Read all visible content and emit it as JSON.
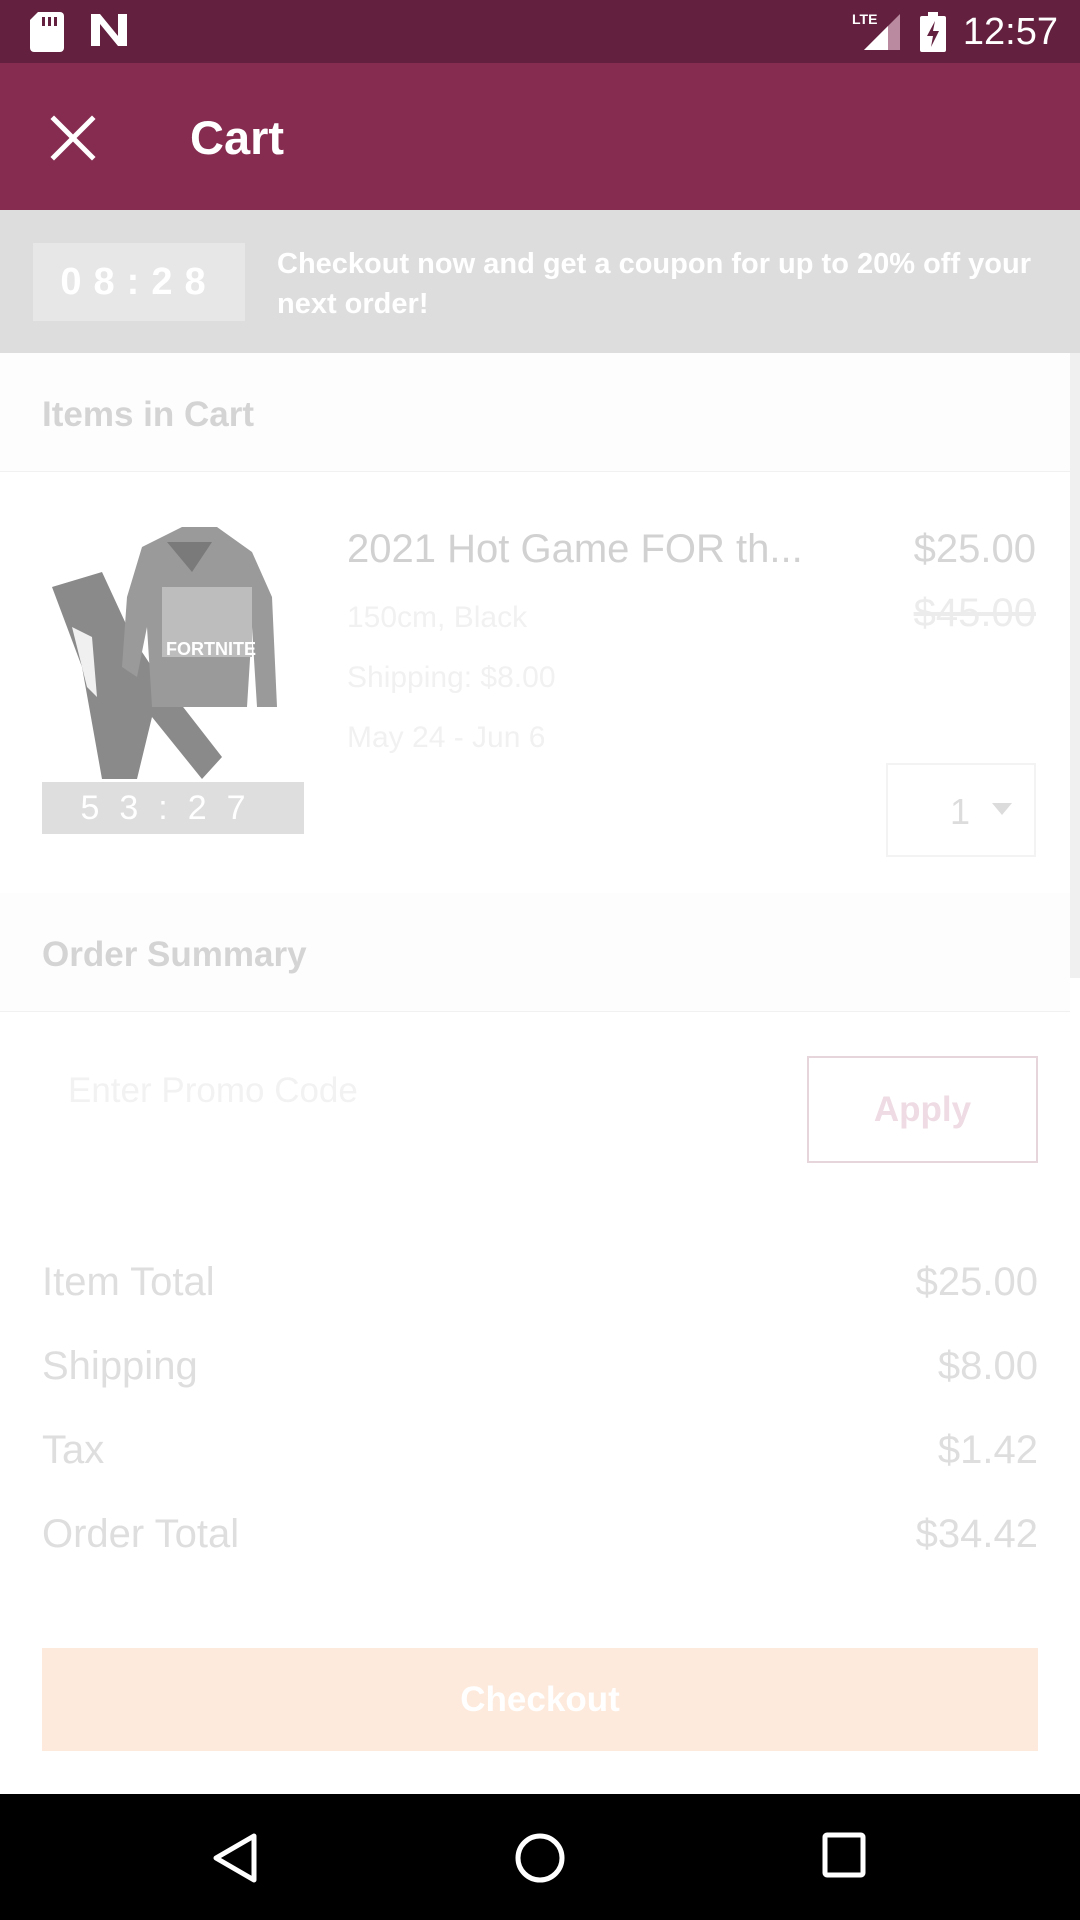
{
  "status_bar": {
    "time": "12:57",
    "network": "LTE"
  },
  "app_bar": {
    "title": "Cart"
  },
  "banner": {
    "timer": "08:28",
    "message": "Checkout now and get a coupon for up to 20% off your next order!"
  },
  "items_section": {
    "title": "Items in Cart"
  },
  "item": {
    "name": "2021 Hot Game FOR th...",
    "price": "$25.00",
    "original_price": "$45.00",
    "variant": "150cm, Black",
    "shipping": "Shipping: $8.00",
    "delivery_dates": "May 24 - Jun 6",
    "timer": "53:27",
    "quantity": "1"
  },
  "order_summary": {
    "title": "Order Summary",
    "promo_placeholder": "Enter Promo Code",
    "apply_label": "Apply",
    "rows": [
      {
        "label": "Item Total",
        "value": "$25.00"
      },
      {
        "label": "Shipping",
        "value": "$8.00"
      },
      {
        "label": "Tax",
        "value": "$1.42"
      },
      {
        "label": "Order Total",
        "value": "$34.42"
      }
    ],
    "checkout_label": "Checkout"
  },
  "colors": {
    "status_bar": "#63203f",
    "app_bar": "#862c50",
    "checkout": "#fdeadc"
  },
  "icons": [
    "sd-card-icon",
    "n-notification-icon",
    "lte-signal-icon",
    "battery-charging-icon",
    "close-icon",
    "back-icon",
    "home-icon",
    "recents-icon"
  ]
}
